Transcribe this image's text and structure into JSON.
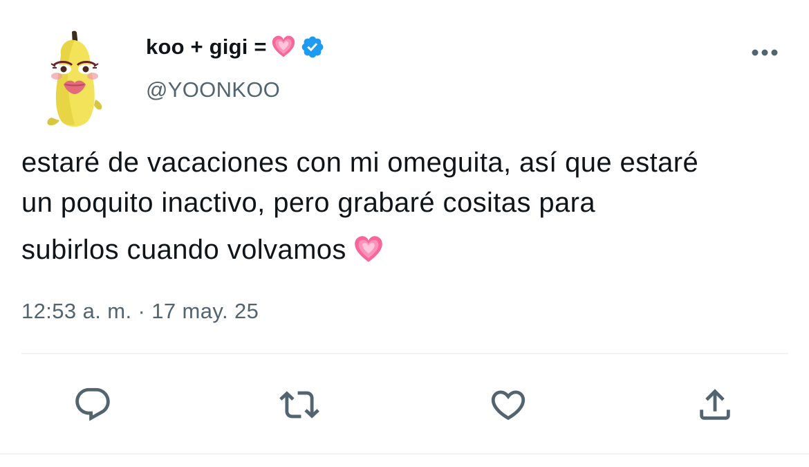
{
  "tweet": {
    "display_name": "koo + gigi =",
    "handle": "@YOONKOO",
    "verified": true,
    "text_lines": [
      "estaré de vacaciones con mi omeguita, así que estaré",
      "un poquito inactivo, pero grabaré cositas para",
      "subirlos cuando volvamos"
    ],
    "timestamp": "12:53 a. m. · 17 may. 25"
  },
  "icons": {
    "avatar": "banana-face-avatar",
    "name_emoji": "growing-heart-icon",
    "badge": "verified-badge-icon",
    "more": "more-options-icon",
    "text_emoji": "growing-heart-icon",
    "reply": "reply-icon",
    "retweet": "retweet-icon",
    "like": "like-heart-icon",
    "share": "share-icon"
  },
  "colors": {
    "text_primary": "#0f1419",
    "text_secondary": "#536471",
    "verified_blue": "#1d9bf0",
    "heart_pink": "#f7679a",
    "divider": "#eff3f4"
  }
}
